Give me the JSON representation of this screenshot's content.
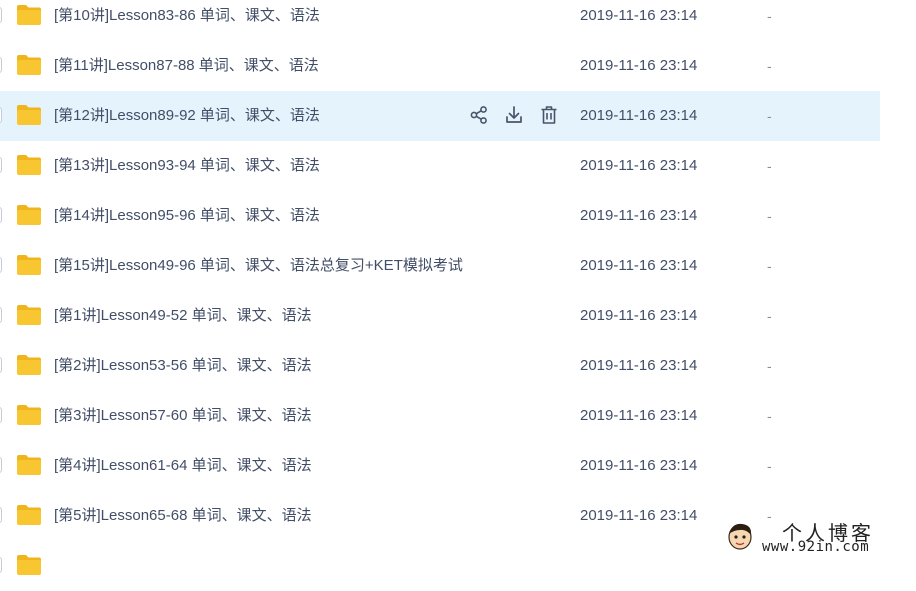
{
  "files": [
    {
      "name": "[第10讲]Lesson83-86 单词、课文、语法",
      "date": "2019-11-16 23:14",
      "size": "-"
    },
    {
      "name": "[第11讲]Lesson87-88 单词、课文、语法",
      "date": "2019-11-16 23:14",
      "size": "-"
    },
    {
      "name": "[第12讲]Lesson89-92 单词、课文、语法",
      "date": "2019-11-16 23:14",
      "size": "-"
    },
    {
      "name": "[第13讲]Lesson93-94 单词、课文、语法",
      "date": "2019-11-16 23:14",
      "size": "-"
    },
    {
      "name": "[第14讲]Lesson95-96 单词、课文、语法",
      "date": "2019-11-16 23:14",
      "size": "-"
    },
    {
      "name": "[第15讲]Lesson49-96 单词、课文、语法总复习+KET模拟考试",
      "date": "2019-11-16 23:14",
      "size": "-"
    },
    {
      "name": "[第1讲]Lesson49-52 单词、课文、语法",
      "date": "2019-11-16 23:14",
      "size": "-"
    },
    {
      "name": "[第2讲]Lesson53-56 单词、课文、语法",
      "date": "2019-11-16 23:14",
      "size": "-"
    },
    {
      "name": "[第3讲]Lesson57-60 单词、课文、语法",
      "date": "2019-11-16 23:14",
      "size": "-"
    },
    {
      "name": "[第4讲]Lesson61-64 单词、课文、语法",
      "date": "2019-11-16 23:14",
      "size": "-"
    },
    {
      "name": "[第5讲]Lesson65-68 单词、课文、语法",
      "date": "2019-11-16 23:14",
      "size": "-"
    },
    {
      "name": "",
      "date": "",
      "size": ""
    }
  ],
  "hovered_index": 2,
  "row_actions": [
    {
      "icon": "share-icon"
    },
    {
      "icon": "download-icon"
    },
    {
      "icon": "delete-icon"
    }
  ],
  "colors": {
    "folder": "#f8c630",
    "folder_tab": "#f0b51c",
    "hover_bg": "#e5f3fd",
    "icon": "#4a5468"
  },
  "watermark": {
    "title": "个人博客",
    "url": "www.92in.com"
  }
}
